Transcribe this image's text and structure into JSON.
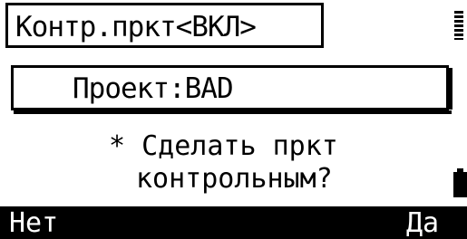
{
  "title": "Контр.пркт<ВКЛ>",
  "project_field": {
    "text": "Проект:BAD"
  },
  "message": {
    "line1": "* Сделать пркт",
    "line2": "контрольным?"
  },
  "softkeys": {
    "left": "Нет",
    "right": "Да"
  },
  "icons": {
    "status": "signal-icon",
    "battery": "battery-icon"
  },
  "colors": {
    "foreground": "#000000",
    "background": "#ffffff"
  }
}
